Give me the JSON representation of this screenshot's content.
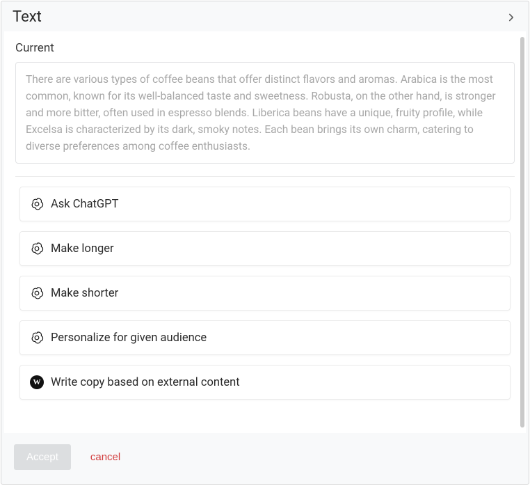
{
  "header": {
    "title": "Text"
  },
  "current": {
    "label": "Current",
    "text": "There are various types of coffee beans that offer distinct flavors and aromas. Arabica is the most common, known for its well-balanced taste and sweetness. Robusta, on the other hand, is stronger and more bitter, often used in espresso blends. Liberica beans have a unique, fruity profile, while Excelsa is characterized by its dark, smoky notes. Each bean brings its own charm, catering to diverse preferences among coffee enthusiasts."
  },
  "actions": [
    {
      "label": "Ask ChatGPT",
      "icon": "openai"
    },
    {
      "label": "Make longer",
      "icon": "openai"
    },
    {
      "label": "Make shorter",
      "icon": "openai"
    },
    {
      "label": "Personalize for given audience",
      "icon": "openai"
    },
    {
      "label": "Write copy based on external content",
      "icon": "solid-w"
    }
  ],
  "footer": {
    "accept": "Accept",
    "cancel": "cancel"
  },
  "icons": {
    "solid_w_letter": "W"
  }
}
